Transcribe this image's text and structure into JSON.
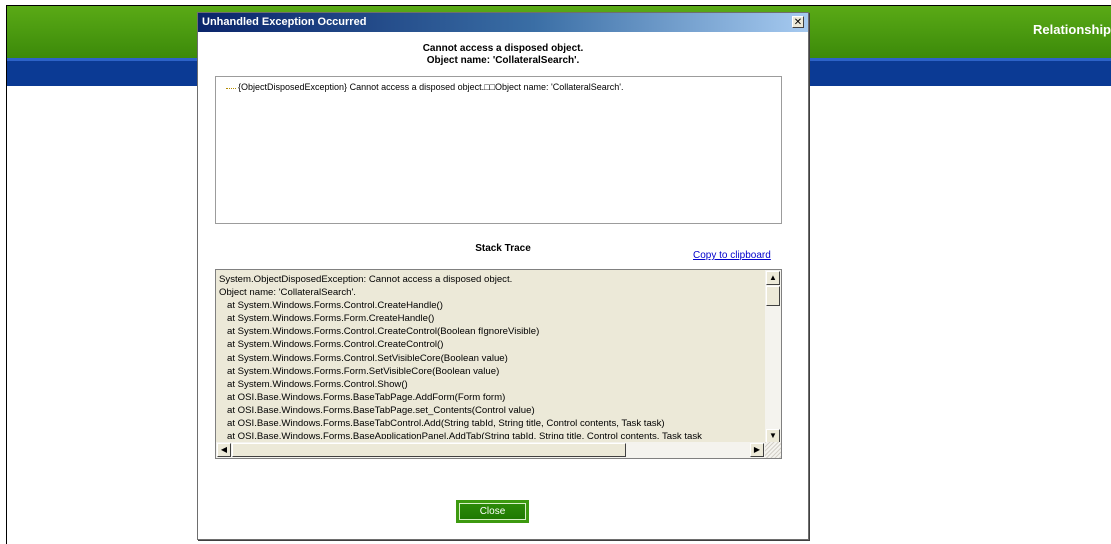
{
  "app": {
    "header_title": "Relationship",
    "colors": {
      "header": "#4e9e12",
      "bar": "#0b3a94"
    }
  },
  "dialog": {
    "title": "Unhandled Exception Occurred",
    "close_icon": "close-icon",
    "message_line1": "Cannot access a disposed object.",
    "message_line2": "Object name: 'CollateralSearch'.",
    "exception_tree_item": "{ObjectDisposedException} Cannot access a disposed object.□□Object name: 'CollateralSearch'.",
    "stack_trace_heading": "Stack Trace",
    "copy_link": "Copy to clipboard",
    "stack_trace": [
      "System.ObjectDisposedException: Cannot access a disposed object.",
      "Object name: 'CollateralSearch'.",
      "   at System.Windows.Forms.Control.CreateHandle()",
      "   at System.Windows.Forms.Form.CreateHandle()",
      "   at System.Windows.Forms.Control.CreateControl(Boolean fIgnoreVisible)",
      "   at System.Windows.Forms.Control.CreateControl()",
      "   at System.Windows.Forms.Control.SetVisibleCore(Boolean value)",
      "   at System.Windows.Forms.Form.SetVisibleCore(Boolean value)",
      "   at System.Windows.Forms.Control.Show()",
      "   at OSI.Base.Windows.Forms.BaseTabPage.AddForm(Form form)",
      "   at OSI.Base.Windows.Forms.BaseTabPage.set_Contents(Control value)",
      "   at OSI.Base.Windows.Forms.BaseTabControl.Add(String tabId, String title, Control contents, Task task)",
      "   at OSI.Base.Windows.Forms.BaseApplicationPanel.AddTab(String tabId, String title, Control contents, Task task"
    ],
    "close_button": "Close"
  }
}
